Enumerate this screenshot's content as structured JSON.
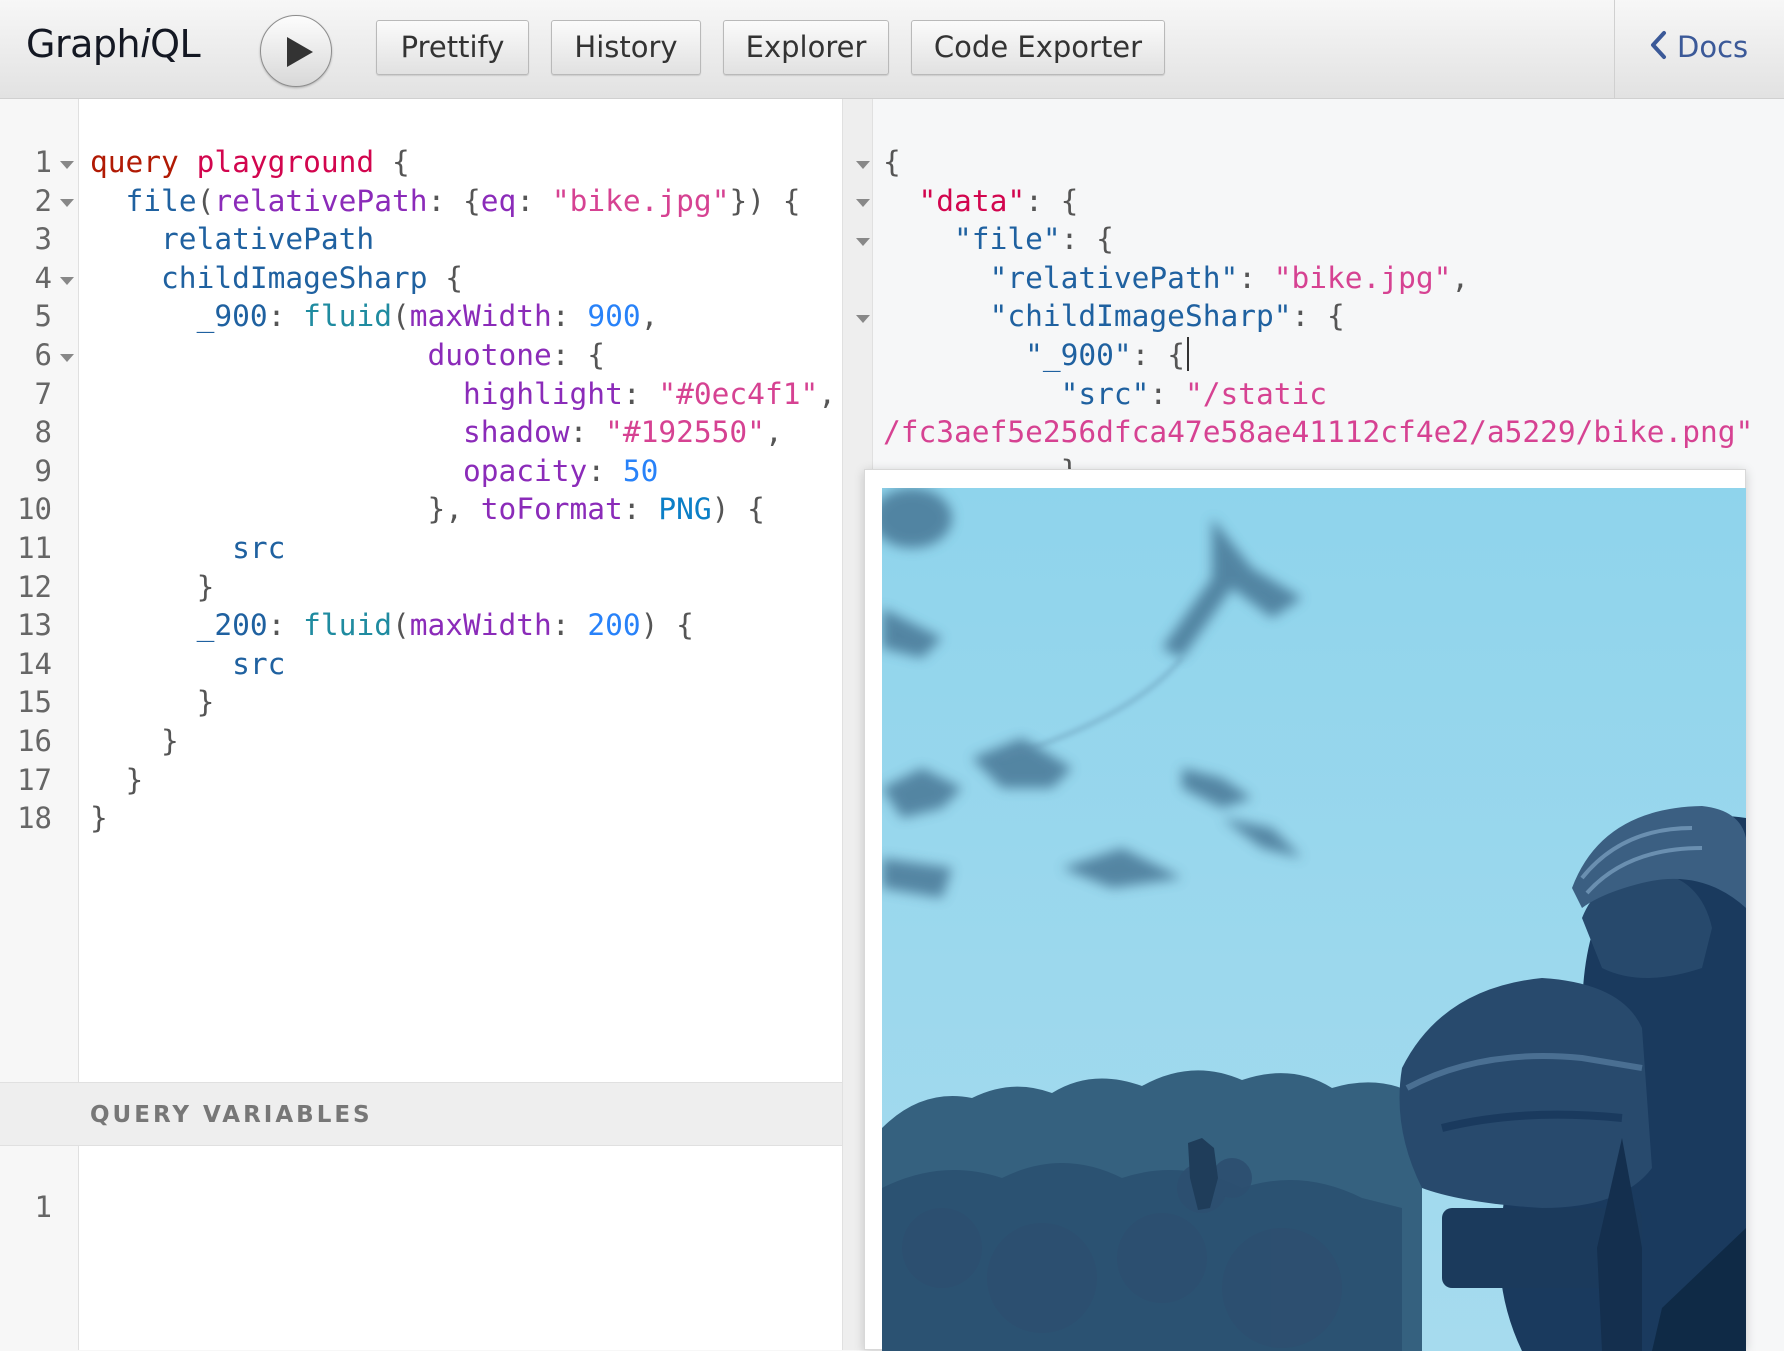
{
  "app": {
    "logo_pre": "Graph",
    "logo_i": "i",
    "logo_post": "QL"
  },
  "toolbar": {
    "run_icon": "play-icon",
    "prettify": "Prettify",
    "history": "History",
    "explorer": "Explorer",
    "code_exporter": "Code Exporter",
    "docs": "Docs",
    "docs_icon": "chevron-left-icon"
  },
  "query_editor": {
    "line_numbers": [
      "1",
      "2",
      "3",
      "4",
      "5",
      "6",
      "7",
      "8",
      "9",
      "10",
      "11",
      "12",
      "13",
      "14",
      "15",
      "16",
      "17",
      "18"
    ],
    "tokens": {
      "l1_kw": "query",
      "l1_name": "playground",
      "l1_brace": "{",
      "l2_field": "file",
      "l2_arg": "relativePath",
      "l2_eq": "eq",
      "l2_str": "\"bike.jpg\"",
      "l3_field": "relativePath",
      "l4_field": "childImageSharp",
      "l5_alias": "_900",
      "l5_field": "fluid",
      "l5_arg": "maxWidth",
      "l5_num": "900",
      "l6_arg": "duotone",
      "l7_arg": "highlight",
      "l7_str": "\"#0ec4f1\"",
      "l8_arg": "shadow",
      "l8_str": "\"#192550\"",
      "l9_arg": "opacity",
      "l9_num": "50",
      "l10_arg": "toFormat",
      "l10_enum": "PNG",
      "l11_field": "src",
      "l13_alias": "_200",
      "l13_field": "fluid",
      "l13_arg": "maxWidth",
      "l13_num": "200",
      "l14_field": "src"
    }
  },
  "variables": {
    "title": "QUERY VARIABLES",
    "line_numbers": [
      "1"
    ]
  },
  "result": {
    "open_brace": "{",
    "k_data": "\"data\"",
    "k_file": "\"file\"",
    "k_relativePath": "\"relativePath\"",
    "v_relativePath": "\"bike.jpg\"",
    "k_childImageSharp": "\"childImageSharp\"",
    "k_900": "\"_900\"",
    "k_src": "\"src\"",
    "v_src_part1": "\"/static",
    "v_src_part2": "/fc3aef5e256dfca47e58ae41112cf4e2/a5229/bike.png\""
  },
  "colors": {
    "duotone_highlight": "#0ec4f1",
    "duotone_shadow": "#192550",
    "docs_link": "#3b5998"
  }
}
